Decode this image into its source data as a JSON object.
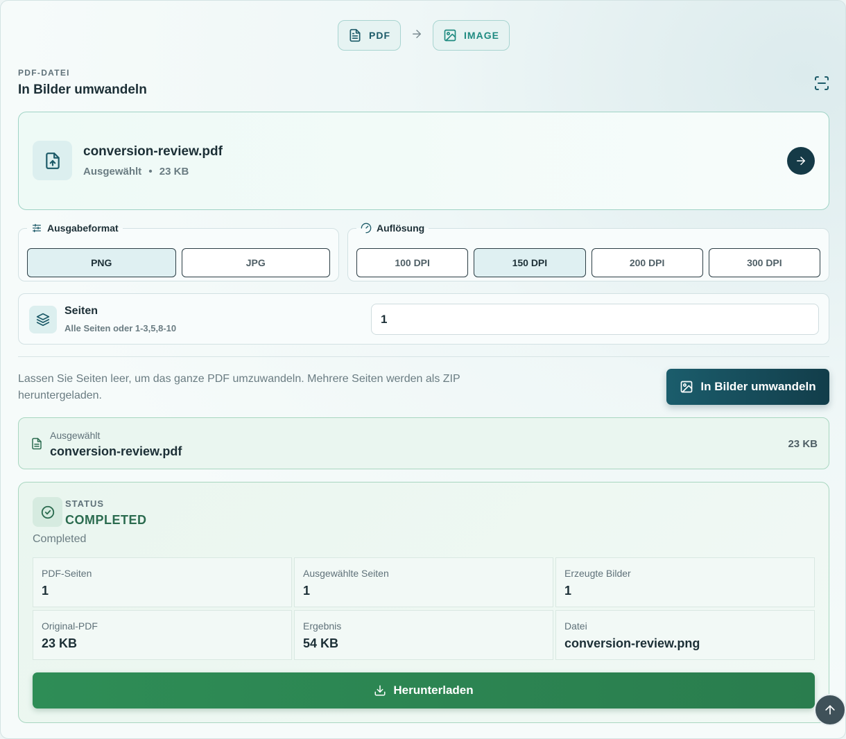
{
  "flow": {
    "from": "PDF",
    "to": "IMAGE"
  },
  "header": {
    "kicker": "PDF-DATEI",
    "title": "In Bilder umwandeln"
  },
  "file": {
    "name": "conversion-review.pdf",
    "state": "Ausgewählt",
    "separator": "•",
    "size": "23 KB"
  },
  "format": {
    "legend": "Ausgabeformat",
    "options": [
      "PNG",
      "JPG"
    ],
    "selected": "PNG"
  },
  "resolution": {
    "legend": "Auflösung",
    "options": [
      "100 DPI",
      "150 DPI",
      "200 DPI",
      "300 DPI"
    ],
    "selected": "150 DPI"
  },
  "pages": {
    "label": "Seiten",
    "hint": "Alle Seiten oder 1-3,5,8-10",
    "value": "1"
  },
  "help_text": "Lassen Sie Seiten leer, um das ganze PDF umzuwandeln. Mehrere Seiten werden als ZIP heruntergeladen.",
  "convert_label": "In Bilder umwandeln",
  "selected_file": {
    "label": "Ausgewählt",
    "name": "conversion-review.pdf",
    "size": "23 KB"
  },
  "status": {
    "kicker": "STATUS",
    "value": "COMPLETED",
    "description": "Completed",
    "stats": [
      {
        "label": "PDF-Seiten",
        "value": "1"
      },
      {
        "label": "Ausgewählte Seiten",
        "value": "1"
      },
      {
        "label": "Erzeugte Bilder",
        "value": "1"
      },
      {
        "label": "Original-PDF",
        "value": "23 KB"
      },
      {
        "label": "Ergebnis",
        "value": "54 KB"
      },
      {
        "label": "Datei",
        "value": "conversion-review.png"
      }
    ],
    "download_label": "Herunterladen"
  },
  "icons": {
    "pdf": "file-text-icon",
    "image": "image-icon",
    "arrow": "arrow-right-icon",
    "scan": "scan-icon",
    "upload": "file-upload-icon",
    "sliders": "sliders-icon",
    "gauge": "gauge-icon",
    "layers": "layers-icon",
    "check": "check-circle-icon",
    "download": "download-icon",
    "up": "arrow-up-icon"
  },
  "colors": {
    "accent": "#153a47",
    "success": "#2e8d56",
    "teal": "#1e8a80"
  }
}
